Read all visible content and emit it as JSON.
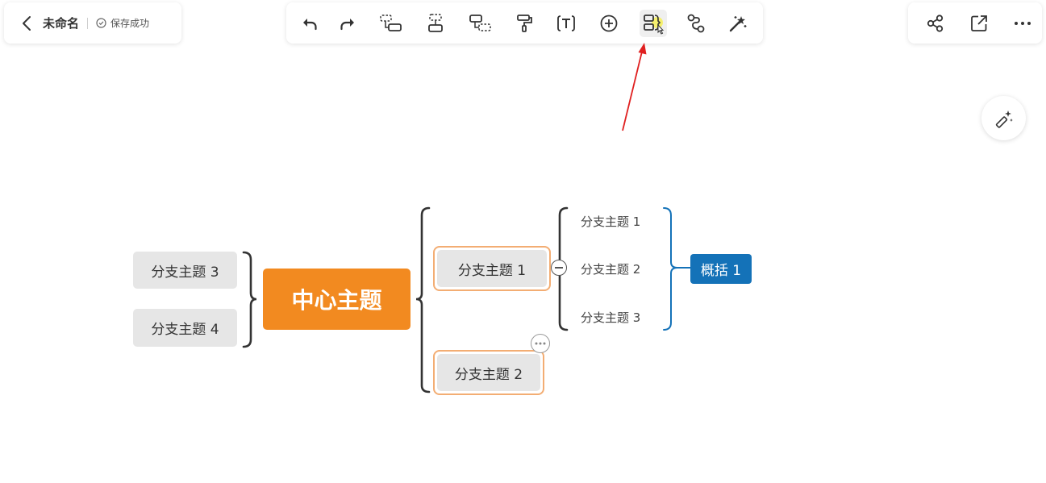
{
  "header": {
    "doc_title": "未命名",
    "save_status": "保存成功"
  },
  "toolbar": {
    "tools": [
      {
        "name": "undo-icon"
      },
      {
        "name": "redo-icon"
      },
      {
        "name": "add-child-topic-icon"
      },
      {
        "name": "add-sibling-topic-icon"
      },
      {
        "name": "add-parent-topic-icon"
      },
      {
        "name": "format-painter-icon"
      },
      {
        "name": "text-icon"
      },
      {
        "name": "insert-icon"
      },
      {
        "name": "summary-icon",
        "active": true
      },
      {
        "name": "relation-line-icon"
      },
      {
        "name": "magic-wand-icon"
      }
    ]
  },
  "right_tools": [
    {
      "name": "share-icon"
    },
    {
      "name": "export-icon"
    },
    {
      "name": "more-icon"
    }
  ],
  "mindmap": {
    "central": "中心主题",
    "left_branches": [
      "分支主题 3",
      "分支主题 4"
    ],
    "right_branches": [
      "分支主题 1",
      "分支主题 2"
    ],
    "subtopics": [
      "分支主题 1",
      "分支主题 2",
      "分支主题 3"
    ],
    "summary": "概括 1"
  },
  "colors": {
    "central": "#f28a20",
    "summary": "#1472b8",
    "selection": "#f3ad73",
    "annotation_arrow": "#e02020",
    "highlight": "#f5f060"
  }
}
